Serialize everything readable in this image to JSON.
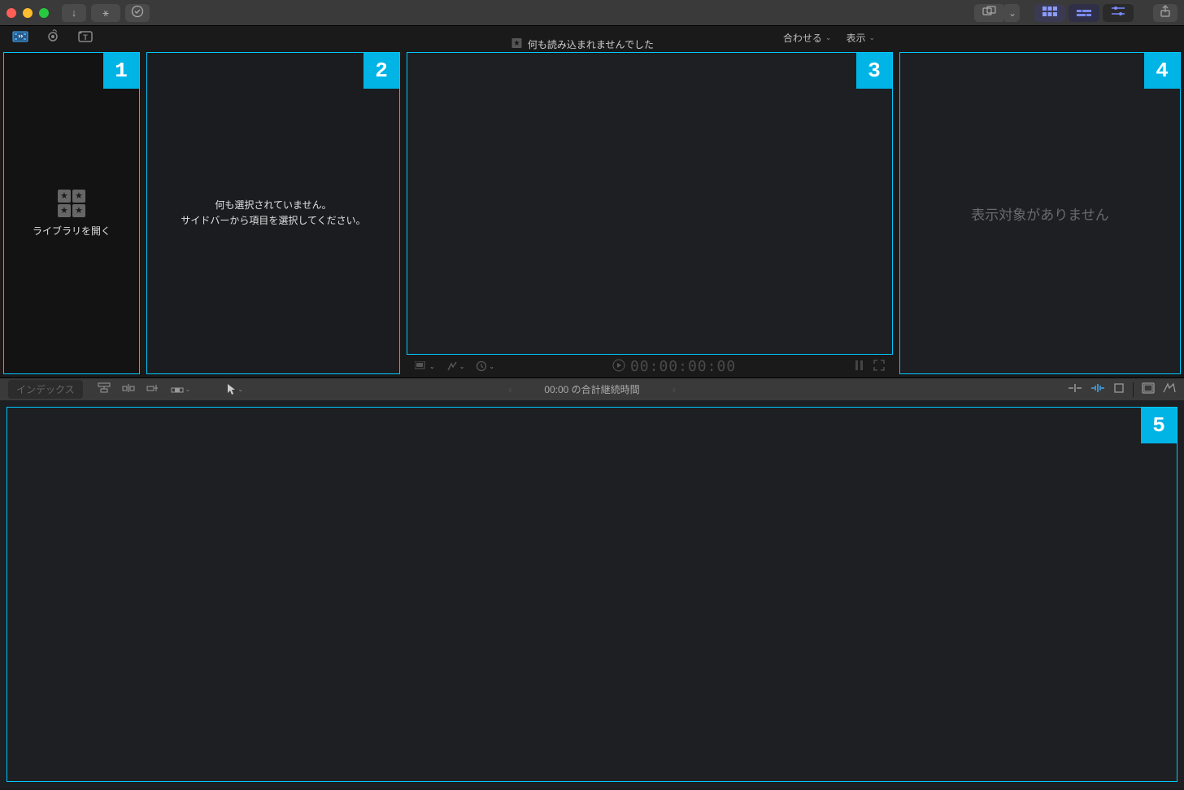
{
  "titlebar": {
    "import_icon": "↓",
    "keyword_icon": "⚿",
    "bgtasks_icon": "✓"
  },
  "subheader_tabs": {
    "media": "media-tab",
    "audio": "audio-tab",
    "titles": "titles-tab"
  },
  "viewer_header": {
    "center_icon": "★",
    "center_text": "何も読み込まれませんでした",
    "fit_menu": "合わせる",
    "view_menu": "表示"
  },
  "area1": {
    "label": "ライブラリを開く"
  },
  "area2": {
    "line1": "何も選択されていません。",
    "line2": "サイドバーから項目を選択してください。"
  },
  "area4": {
    "text": "表示対象がありません"
  },
  "viewer_footer": {
    "timecode": "00:00:00:00"
  },
  "tl_header": {
    "index": "インデックス",
    "center_text": "00:00 の合計継続時間"
  },
  "badges": {
    "b1": "1",
    "b2": "2",
    "b3": "3",
    "b4": "4",
    "b5": "5"
  }
}
